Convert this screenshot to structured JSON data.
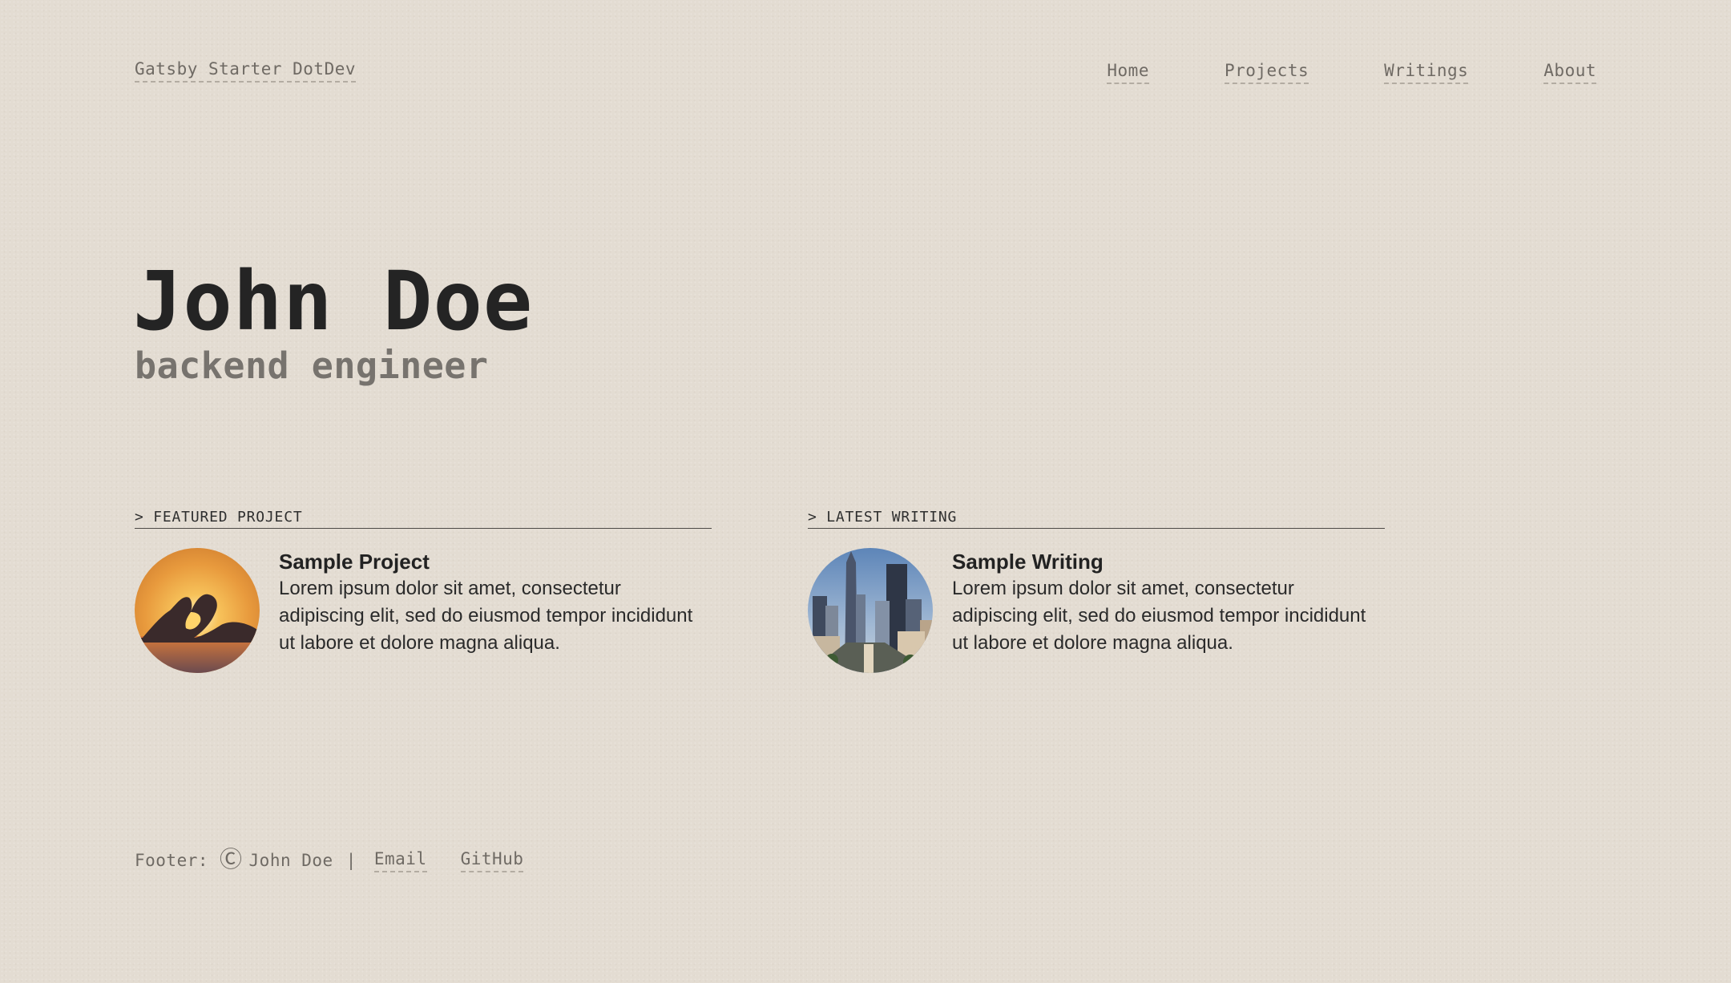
{
  "header": {
    "site_title": "Gatsby Starter DotDev",
    "nav": [
      {
        "label": "Home"
      },
      {
        "label": "Projects"
      },
      {
        "label": "Writings"
      },
      {
        "label": "About"
      }
    ]
  },
  "hero": {
    "name": "John Doe",
    "role": "backend engineer"
  },
  "featured_project": {
    "heading": "> FEATURED PROJECT",
    "title": "Sample Project",
    "description": "Lorem ipsum dolor sit amet, consectetur adipiscing elit, sed do eiusmod tempor incididunt ut labore et dolore magna aliqua.",
    "image_icon": "heart-hands-sunset-image"
  },
  "latest_writing": {
    "heading": "> LATEST WRITING",
    "title": "Sample Writing",
    "description": "Lorem ipsum dolor sit amet, consectetur adipiscing elit, sed do eiusmod tempor incididunt ut labore et dolore magna aliqua.",
    "image_icon": "city-skyline-image"
  },
  "footer": {
    "prefix": "Footer:",
    "copyright_symbol": "Ⓒ",
    "owner": "John Doe",
    "separator": "|",
    "links": [
      {
        "label": "Email"
      },
      {
        "label": "GitHub"
      }
    ]
  },
  "colors": {
    "background": "#e3dcd2",
    "text_dark": "#242424",
    "text_muted": "#6f6a64",
    "role_gray": "#77736e"
  }
}
